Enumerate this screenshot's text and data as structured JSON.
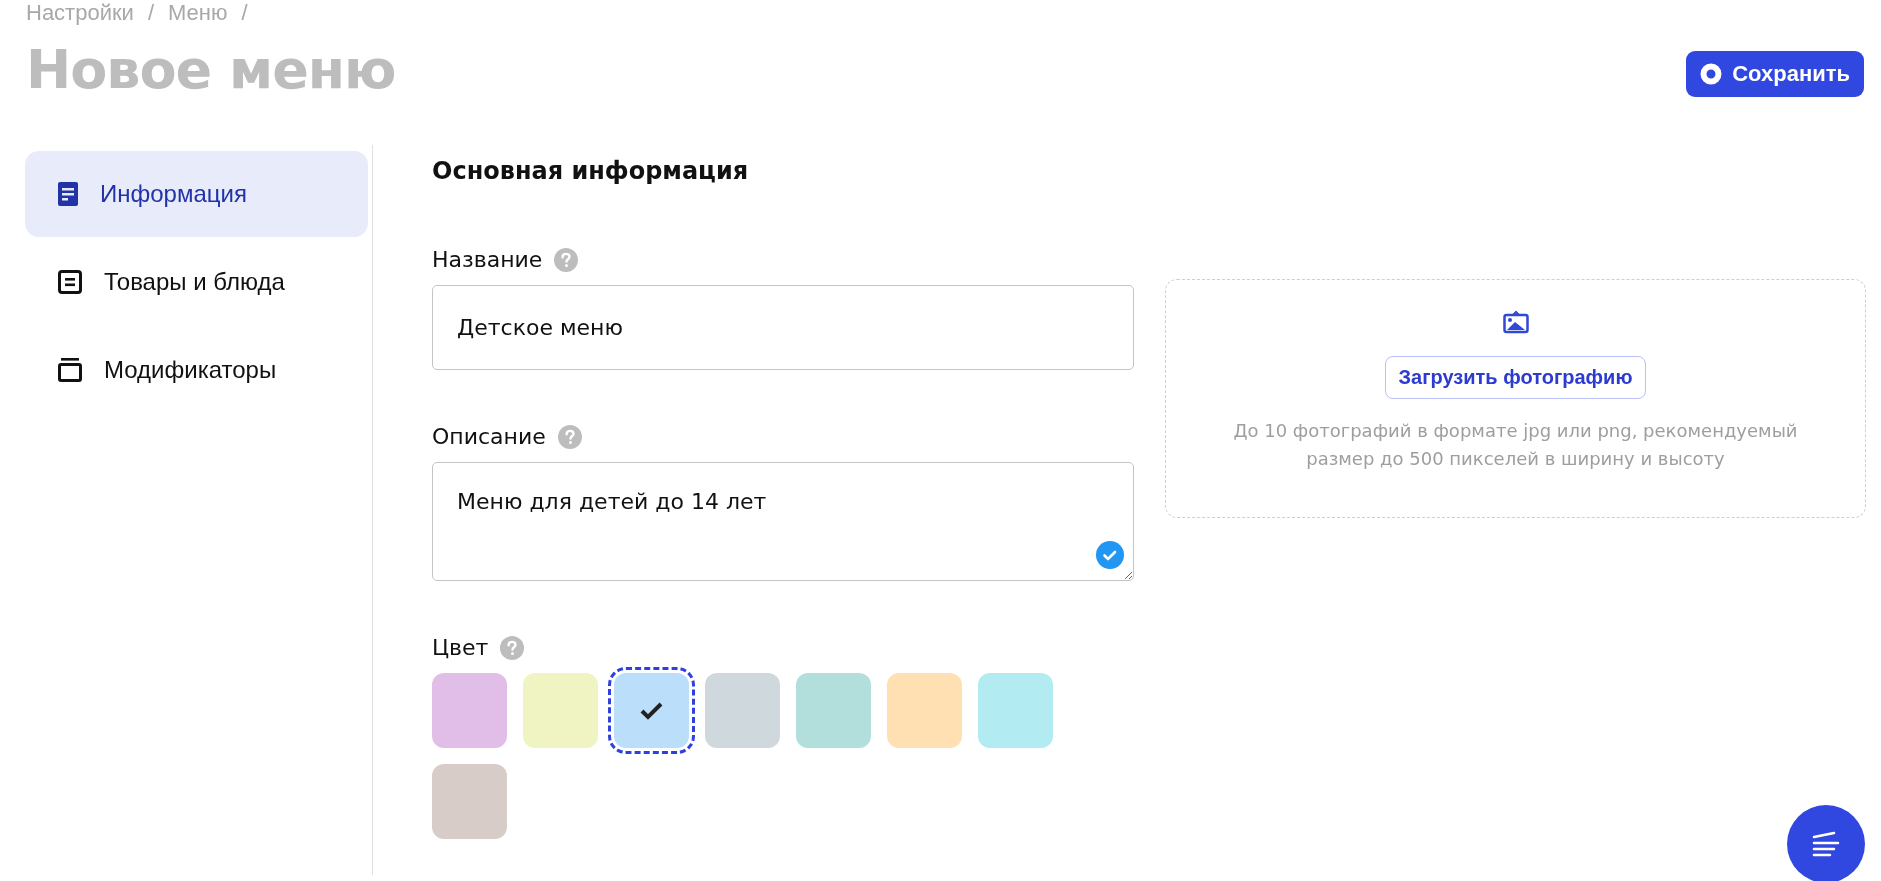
{
  "breadcrumbs": {
    "separator": "/",
    "items": [
      {
        "label": "Настройки"
      },
      {
        "label": "Меню"
      }
    ]
  },
  "title": "Новое меню",
  "save_button": {
    "label": "Сохранить"
  },
  "sidebar": {
    "items": [
      {
        "label": "Информация",
        "kind": "info",
        "selected": true
      },
      {
        "label": "Товары и блюда",
        "kind": "list",
        "selected": false
      },
      {
        "label": "Модификаторы",
        "kind": "stack",
        "selected": false
      }
    ]
  },
  "section_title": "Основная информация",
  "fields": [
    {
      "label": "Название",
      "kind": "text",
      "value": "Детское меню"
    },
    {
      "label": "Описание",
      "kind": "textarea",
      "value": "Меню для детей до 14 лет",
      "checked": true
    }
  ],
  "color_picker": {
    "label": "Цвет",
    "swatches": [
      {
        "color": "#e1bee7",
        "selected": false
      },
      {
        "color": "#f0f4c3",
        "selected": false
      },
      {
        "color": "#bbdefb",
        "selected": true
      },
      {
        "color": "#cfd8dc",
        "selected": false
      },
      {
        "color": "#b2dfdb",
        "selected": false
      },
      {
        "color": "#ffe0b2",
        "selected": false
      },
      {
        "color": "#b2ebf2",
        "selected": false
      },
      {
        "color": "#d7ccc8",
        "selected": false
      }
    ]
  },
  "upload": {
    "button": "Загрузить фотографию",
    "hint": "До 10 фотографий в формате jpg или png, рекомендуемый размер до 500 пикселей в ширину и высоту"
  }
}
